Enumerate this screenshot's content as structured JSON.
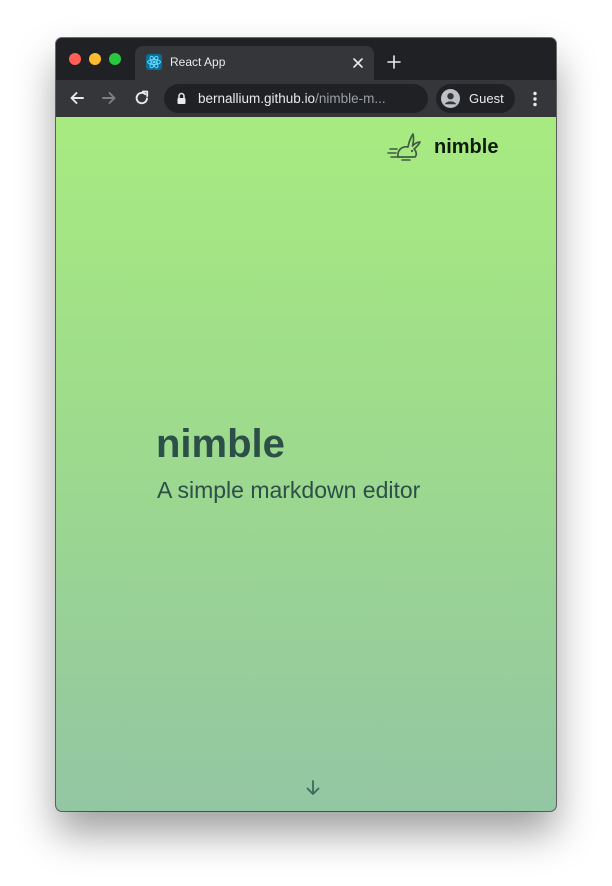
{
  "browser": {
    "tab": {
      "title": "React App"
    },
    "address_bar": {
      "host": "bernallium.github.io",
      "path": "/nimble-m..."
    },
    "profile": {
      "label": "Guest"
    },
    "icons": [
      "back-icon",
      "forward-icon",
      "reload-icon",
      "lock-icon",
      "profile-icon",
      "more-menu-icon",
      "close-icon",
      "plus-icon",
      "react-favicon-icon"
    ]
  },
  "site": {
    "brand_name": "nimble",
    "hero": {
      "title": "nimble",
      "subtitle": "A simple markdown editor"
    },
    "colors": {
      "gradient_top": "#a7eb80",
      "gradient_bottom": "#93c6a3",
      "heading": "#2c4f48"
    }
  }
}
